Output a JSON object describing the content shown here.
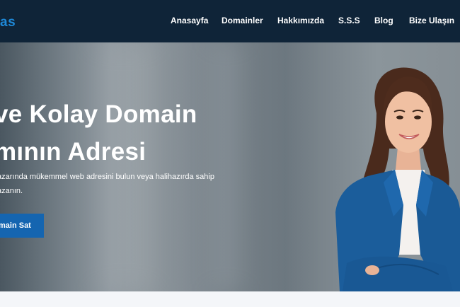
{
  "header": {
    "logo_text": "as",
    "nav": [
      {
        "label": "Anasayfa"
      },
      {
        "label": "Domainler"
      },
      {
        "label": "Hakkımızda"
      },
      {
        "label": "S.S.S"
      },
      {
        "label": "Blog"
      },
      {
        "label": "Bize Ulaşın"
      }
    ]
  },
  "hero": {
    "headline_line1": "ve Kolay Domain",
    "headline_line2": "mının Adresi",
    "subtext_line1": "azarında mükemmel web adresini bulun veya halihazırda sahip",
    "subtext_line2": "azanın.",
    "cta_label": "main Sat",
    "colors": {
      "navbar": "#0f2438",
      "logo": "#1e88d6",
      "cta": "#1565b0",
      "jacket": "#1b5d9b"
    }
  }
}
